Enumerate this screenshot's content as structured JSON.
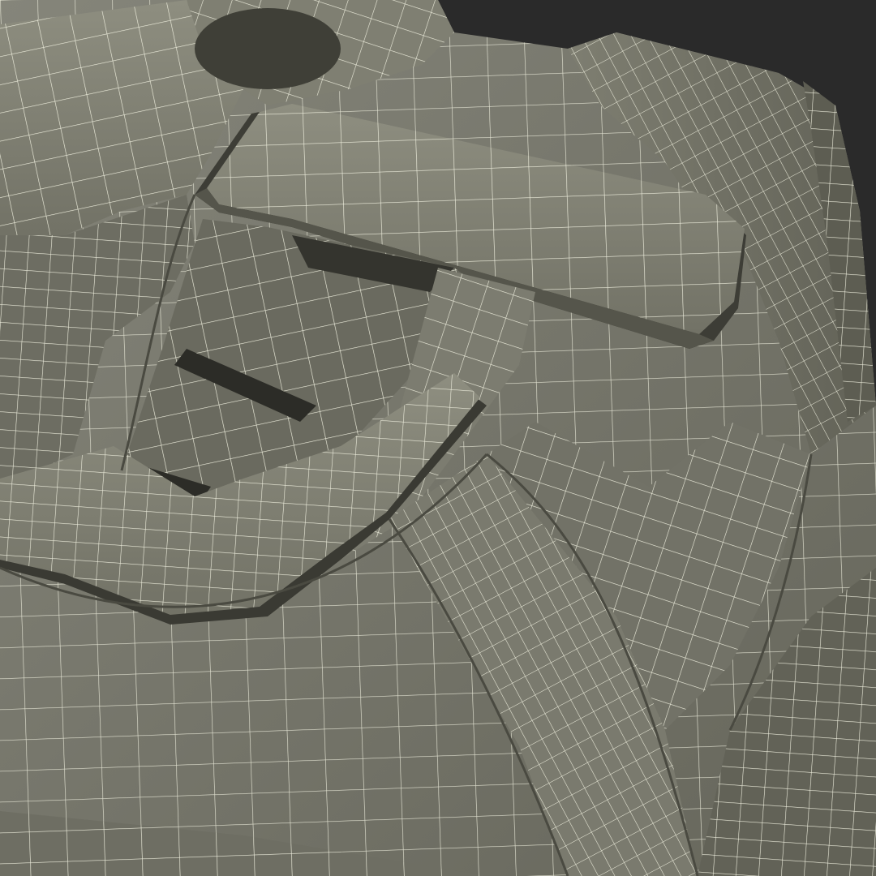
{
  "render": {
    "subject": "sneaker-wireframe",
    "colors": {
      "background": "#2a2a2a",
      "surface_light": "#8a8a7c",
      "surface_mid": "#77776a",
      "surface_dark": "#5f5f54",
      "shadow": "#3a3a33",
      "wire": "#eeeedd"
    }
  }
}
